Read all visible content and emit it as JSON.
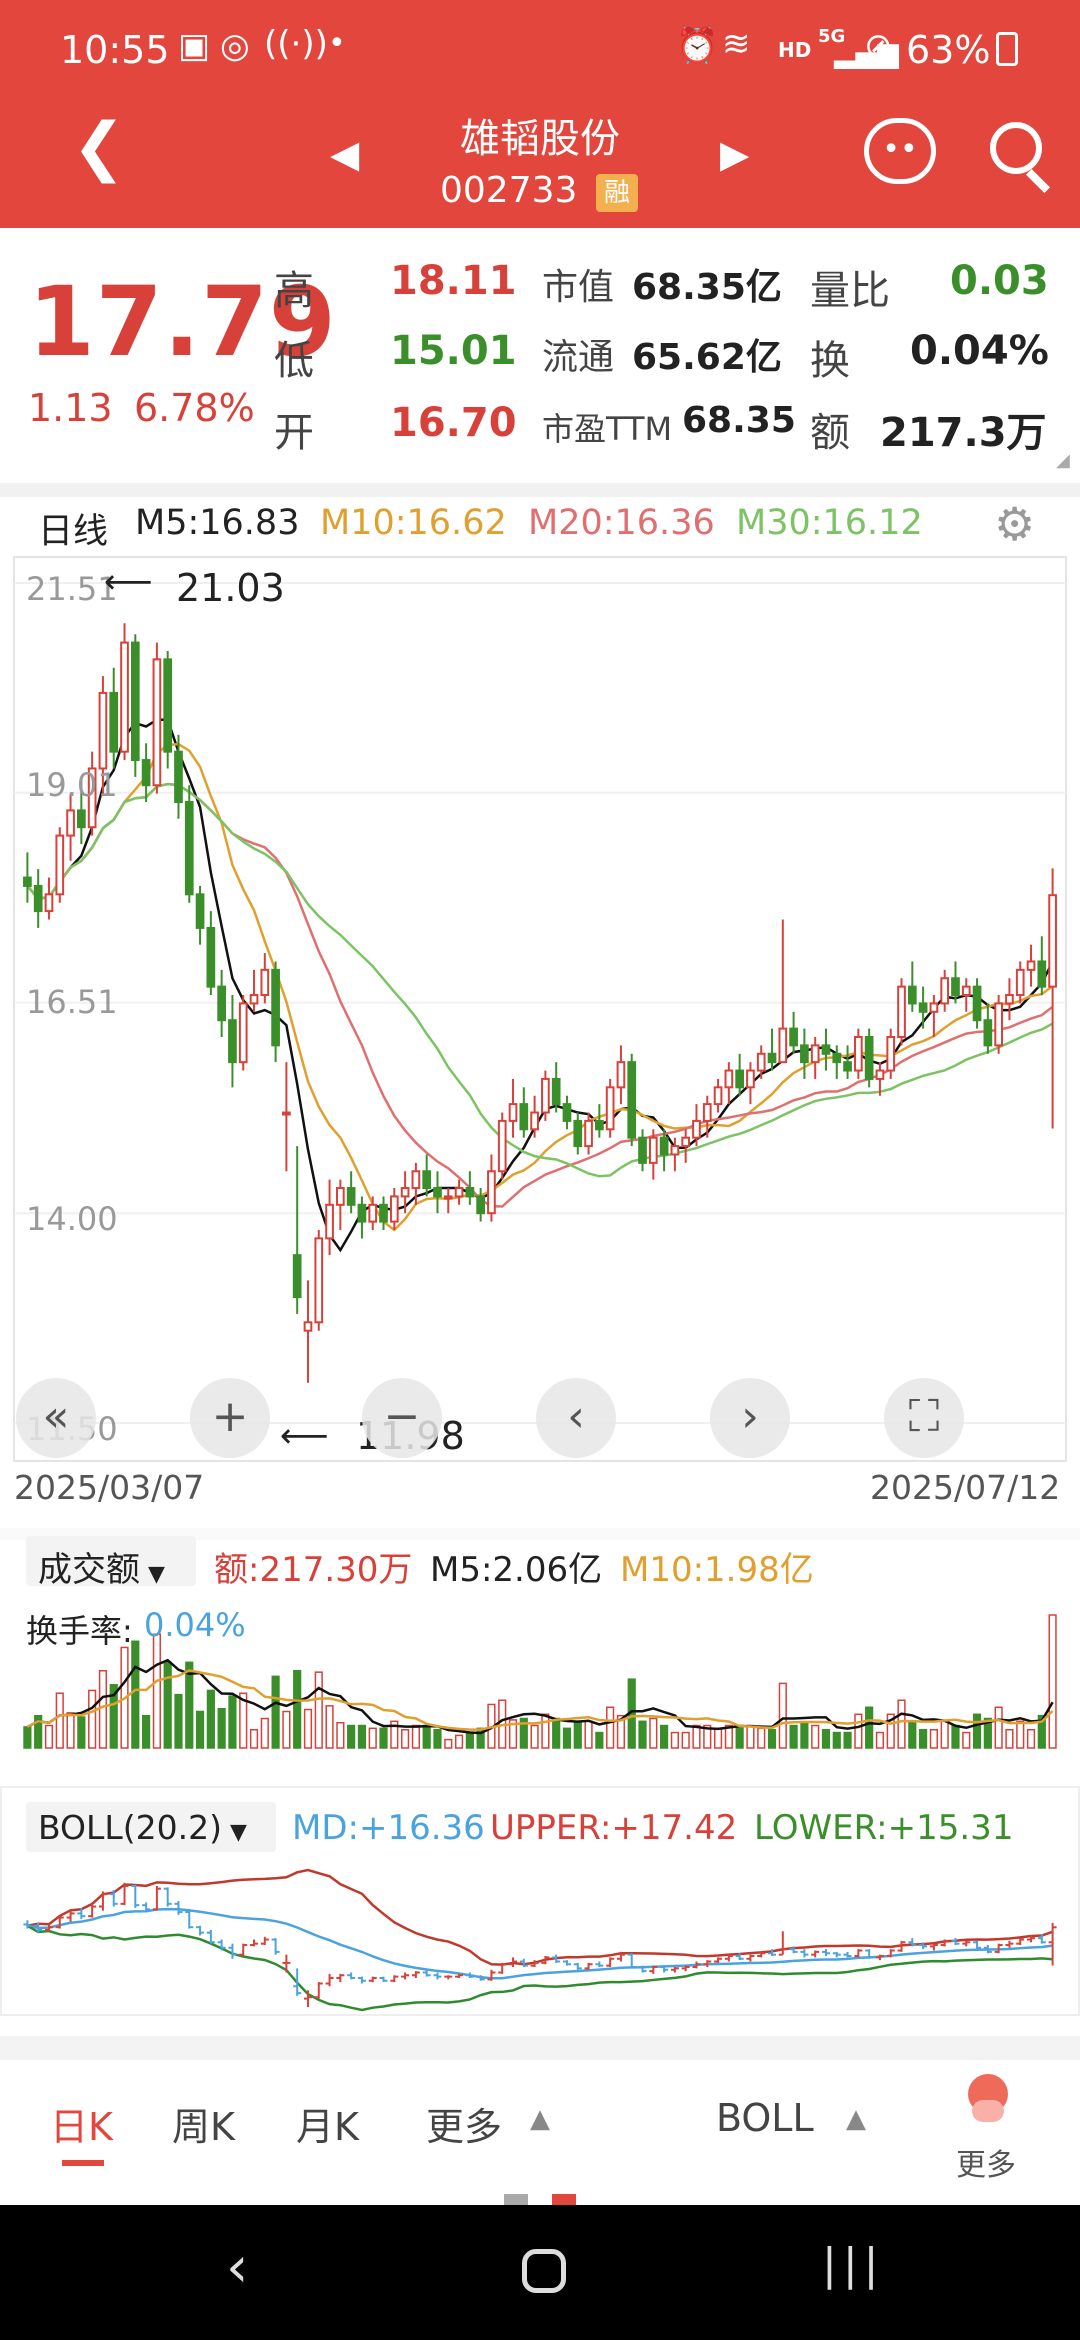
{
  "status": {
    "time": "10:55",
    "hd": "HD",
    "net": "5G",
    "battery": "63%"
  },
  "header": {
    "name": "雄韬股份",
    "code": "002733",
    "badge": "融"
  },
  "quote": {
    "price": "17.79",
    "change": "1.13",
    "pct": "6.78%",
    "high_l": "高",
    "high": "18.11",
    "low_l": "低",
    "low": "15.01",
    "open_l": "开",
    "open": "16.70",
    "cap_l": "市值",
    "cap": "68.35亿",
    "float_l": "流通",
    "float": "65.62亿",
    "pe_l": "市盈TTM",
    "pe": "68.35",
    "vr_l": "量比",
    "vr": "0.03",
    "tr_l": "换",
    "tr": "0.04%",
    "amt_l": "额",
    "amt": "217.3万"
  },
  "kline": {
    "period": "日线",
    "m5": "M5:16.83",
    "m10": "M10:16.62",
    "m20": "M20:16.36",
    "m30": "M30:16.12",
    "y1": "21.51",
    "y2": "19.01",
    "y3": "16.51",
    "y4": "14.00",
    "y5": "11.50",
    "max_label": "21.03",
    "min_label": "11.98",
    "start_date": "2025/03/07",
    "end_date": "2025/07/12"
  },
  "volume": {
    "selector": "成交额",
    "amt": "额:217.30万",
    "m5": "M5:2.06亿",
    "m10": "M10:1.98亿",
    "turn_label": "换手率:",
    "turn_value": "0.04%"
  },
  "boll": {
    "selector": "BOLL(20.2)",
    "md": "MD:+16.36",
    "upper": "UPPER:+17.42",
    "lower": "LOWER:+15.31"
  },
  "tabs": {
    "day": "日K",
    "week": "周K",
    "month": "月K",
    "more": "更多",
    "indicator": "BOLL",
    "more2": "更多"
  },
  "colors": {
    "up": "#d8413a",
    "down": "#3a8f2a",
    "m5": "#111111",
    "m10": "#e0a030",
    "m20": "#e07070",
    "m30": "#7cc463",
    "md": "#4aa3df"
  },
  "chart_data": {
    "type": "candlestick",
    "yticks": [
      21.51,
      19.01,
      16.51,
      14.0,
      11.5
    ],
    "ylim": [
      11.5,
      21.51
    ],
    "x_range": [
      "2025/03/07",
      "2025/07/12"
    ],
    "max": 21.03,
    "min": 11.98,
    "ohlc": [
      [
        18.0,
        18.3,
        17.7,
        17.9
      ],
      [
        17.9,
        18.1,
        17.4,
        17.6
      ],
      [
        17.6,
        18.0,
        17.5,
        17.8
      ],
      [
        17.8,
        18.6,
        17.7,
        18.5
      ],
      [
        18.5,
        19.0,
        18.2,
        18.8
      ],
      [
        18.8,
        19.2,
        18.4,
        18.6
      ],
      [
        18.6,
        19.5,
        18.5,
        19.3
      ],
      [
        19.3,
        20.4,
        19.0,
        20.2
      ],
      [
        20.2,
        20.5,
        19.3,
        19.5
      ],
      [
        19.5,
        21.03,
        19.4,
        20.8
      ],
      [
        20.8,
        20.9,
        19.2,
        19.4
      ],
      [
        19.4,
        19.6,
        18.9,
        19.1
      ],
      [
        19.1,
        20.8,
        19.0,
        20.6
      ],
      [
        20.6,
        20.7,
        19.3,
        19.5
      ],
      [
        19.5,
        19.7,
        18.7,
        18.9
      ],
      [
        18.9,
        19.1,
        17.7,
        17.8
      ],
      [
        17.8,
        17.9,
        17.2,
        17.4
      ],
      [
        17.4,
        17.6,
        16.6,
        16.7
      ],
      [
        16.7,
        16.9,
        16.1,
        16.3
      ],
      [
        16.3,
        16.6,
        15.5,
        15.8
      ],
      [
        15.8,
        16.6,
        15.7,
        16.5
      ],
      [
        16.5,
        16.9,
        16.4,
        16.6
      ],
      [
        16.6,
        17.1,
        16.5,
        16.9
      ],
      [
        16.9,
        17.0,
        15.8,
        16.0
      ],
      [
        15.2,
        15.8,
        14.5,
        15.2
      ],
      [
        13.5,
        14.8,
        12.8,
        13.0
      ],
      [
        12.6,
        13.2,
        11.98,
        12.7
      ],
      [
        12.7,
        13.8,
        12.6,
        13.7
      ],
      [
        13.7,
        14.4,
        13.5,
        14.1
      ],
      [
        14.1,
        14.4,
        13.8,
        14.3
      ],
      [
        14.3,
        14.5,
        14.0,
        14.1
      ],
      [
        14.1,
        14.2,
        13.7,
        13.9
      ],
      [
        13.9,
        14.2,
        13.8,
        14.1
      ],
      [
        14.1,
        14.2,
        13.8,
        13.9
      ],
      [
        13.9,
        14.3,
        13.8,
        14.2
      ],
      [
        14.2,
        14.5,
        14.0,
        14.3
      ],
      [
        14.3,
        14.6,
        14.1,
        14.5
      ],
      [
        14.5,
        14.7,
        14.2,
        14.3
      ],
      [
        14.3,
        14.5,
        14.0,
        14.2
      ],
      [
        14.2,
        14.3,
        14.0,
        14.2
      ],
      [
        14.2,
        14.4,
        14.1,
        14.3
      ],
      [
        14.3,
        14.5,
        14.1,
        14.2
      ],
      [
        14.2,
        14.3,
        13.9,
        14.0
      ],
      [
        14.0,
        14.7,
        13.9,
        14.5
      ],
      [
        14.5,
        15.2,
        14.4,
        15.1
      ],
      [
        15.1,
        15.6,
        14.9,
        15.3
      ],
      [
        15.3,
        15.5,
        14.9,
        15.0
      ],
      [
        15.0,
        15.4,
        14.9,
        15.2
      ],
      [
        15.2,
        15.7,
        15.1,
        15.6
      ],
      [
        15.6,
        15.8,
        15.2,
        15.3
      ],
      [
        15.3,
        15.4,
        15.0,
        15.1
      ],
      [
        15.1,
        15.2,
        14.7,
        14.8
      ],
      [
        14.8,
        15.2,
        14.7,
        15.1
      ],
      [
        15.1,
        15.3,
        14.9,
        15.0
      ],
      [
        15.0,
        15.6,
        14.9,
        15.5
      ],
      [
        15.5,
        16.0,
        15.3,
        15.8
      ],
      [
        15.8,
        15.9,
        14.8,
        14.9
      ],
      [
        14.9,
        15.0,
        14.5,
        14.6
      ],
      [
        14.6,
        15.0,
        14.4,
        14.9
      ],
      [
        14.9,
        15.0,
        14.5,
        14.7
      ],
      [
        14.7,
        14.9,
        14.5,
        14.8
      ],
      [
        14.8,
        15.0,
        14.6,
        14.9
      ],
      [
        14.9,
        15.3,
        14.8,
        15.1
      ],
      [
        15.1,
        15.4,
        14.9,
        15.3
      ],
      [
        15.3,
        15.6,
        15.2,
        15.5
      ],
      [
        15.5,
        15.8,
        15.3,
        15.7
      ],
      [
        15.7,
        15.9,
        15.4,
        15.5
      ],
      [
        15.5,
        15.8,
        15.3,
        15.7
      ],
      [
        15.7,
        16.0,
        15.6,
        15.9
      ],
      [
        15.9,
        16.2,
        15.7,
        15.8
      ],
      [
        15.8,
        17.5,
        15.8,
        16.2
      ],
      [
        16.2,
        16.4,
        15.9,
        16.0
      ],
      [
        16.0,
        16.2,
        15.6,
        15.8
      ],
      [
        15.8,
        16.1,
        15.6,
        16.0
      ],
      [
        16.0,
        16.2,
        15.7,
        15.9
      ],
      [
        15.9,
        16.0,
        15.6,
        15.8
      ],
      [
        15.8,
        16.0,
        15.6,
        15.7
      ],
      [
        15.7,
        16.2,
        15.6,
        16.1
      ],
      [
        16.1,
        16.2,
        15.5,
        15.6
      ],
      [
        15.6,
        15.8,
        15.4,
        15.7
      ],
      [
        15.7,
        16.2,
        15.6,
        16.1
      ],
      [
        16.1,
        16.8,
        16.0,
        16.7
      ],
      [
        16.7,
        17.0,
        16.4,
        16.5
      ],
      [
        16.5,
        16.7,
        16.2,
        16.4
      ],
      [
        16.4,
        16.6,
        16.1,
        16.5
      ],
      [
        16.5,
        16.9,
        16.4,
        16.8
      ],
      [
        16.8,
        17.0,
        16.5,
        16.6
      ],
      [
        16.6,
        16.8,
        16.4,
        16.7
      ],
      [
        16.7,
        16.8,
        16.2,
        16.3
      ],
      [
        16.3,
        16.5,
        15.9,
        16.0
      ],
      [
        16.0,
        16.6,
        15.9,
        16.5
      ],
      [
        16.5,
        16.8,
        16.3,
        16.6
      ],
      [
        16.6,
        17.0,
        16.5,
        16.9
      ],
      [
        16.9,
        17.2,
        16.7,
        17.0
      ],
      [
        17.0,
        17.3,
        16.6,
        16.7
      ],
      [
        16.7,
        18.11,
        15.01,
        17.79
      ]
    ]
  }
}
